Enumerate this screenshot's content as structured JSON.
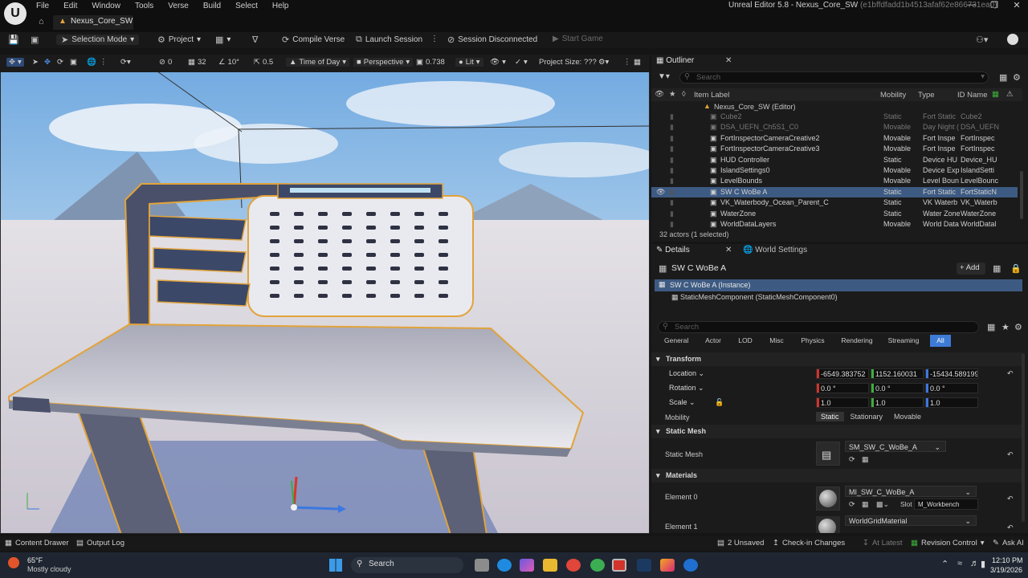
{
  "menu": [
    "File",
    "Edit",
    "Window",
    "Tools",
    "Verse",
    "Build",
    "Select",
    "Help"
  ],
  "window_title": "Unreal Editor 5.8 - Nexus_Core_SW",
  "window_hash": "(e1bffdfadd1b4513afaf62e866731ea0)",
  "tab_label": "Nexus_Core_SW",
  "toolbar": {
    "selection_mode": "Selection Mode",
    "project": "Project",
    "compile_verse": "Compile Verse",
    "launch_session": "Launch Session",
    "session_status": "Session Disconnected",
    "start_game": "Start Game"
  },
  "viewport_toolbar": {
    "snap_translate": "0",
    "grid": "32",
    "snap_rotate": "10°",
    "snap_scale": "0.5",
    "time_of_day": "Time of Day",
    "perspective": "Perspective",
    "camera_speed": "0.738",
    "lit": "Lit",
    "project_size": "Project Size: ???"
  },
  "outliner": {
    "tab": "Outliner",
    "search_placeholder": "Search",
    "columns": {
      "label": "Item Label",
      "mobility": "Mobility",
      "type": "Type",
      "id": "ID Name"
    },
    "root": "Nexus_Core_SW (Editor)",
    "rows": [
      {
        "label": "Cube2",
        "mobility": "Static",
        "type": "Fort Static",
        "id": "Cube2",
        "faded": true
      },
      {
        "label": "DSA_UEFN_Ch5S1_C0",
        "mobility": "Movable",
        "type": "Day Night (",
        "id": "DSA_UEFN",
        "faded": true
      },
      {
        "label": "FortInspectorCameraCreative2",
        "mobility": "Movable",
        "type": "Fort Inspe",
        "id": "FortInspec"
      },
      {
        "label": "FortInspectorCameraCreative3",
        "mobility": "Movable",
        "type": "Fort Inspe",
        "id": "FortInspec"
      },
      {
        "label": "HUD Controller",
        "mobility": "Static",
        "type": "Device HU",
        "id": "Device_HU"
      },
      {
        "label": "IslandSettings0",
        "mobility": "Movable",
        "type": "Device Exp",
        "id": "IslandSetti"
      },
      {
        "label": "LevelBounds",
        "mobility": "Movable",
        "type": "Level Boun",
        "id": "LevelBounc"
      },
      {
        "label": "SW C WoBe A",
        "mobility": "Static",
        "type": "Fort Static",
        "id": "FortStaticN",
        "selected": true
      },
      {
        "label": "VK_Waterbody_Ocean_Parent_C",
        "mobility": "Static",
        "type": "VK Waterb",
        "id": "VK_Waterb"
      },
      {
        "label": "WaterZone",
        "mobility": "Static",
        "type": "Water Zone",
        "id": "WaterZone"
      },
      {
        "label": "WorldDataLayers",
        "mobility": "Movable",
        "type": "World Data",
        "id": "WorldDatal"
      }
    ],
    "actor_count": "32 actors (1 selected)"
  },
  "details": {
    "tab": "Details",
    "tab2": "World Settings",
    "object_name": "SW C WoBe A",
    "add_label": "Add",
    "instance": "SW C WoBe A (Instance)",
    "component": "StaticMeshComponent (StaticMeshComponent0)",
    "search_placeholder": "Search",
    "filters": [
      "General",
      "Actor",
      "LOD",
      "Misc",
      "Physics",
      "Rendering",
      "Streaming",
      "All"
    ],
    "transform_header": "Transform",
    "location_label": "Location",
    "location": [
      "-6549.383752",
      "1152.160031",
      "-15434.589199"
    ],
    "rotation_label": "Rotation",
    "rotation": [
      "0.0 °",
      "0.0 °",
      "0.0 °"
    ],
    "scale_label": "Scale",
    "scale": [
      "1.0",
      "1.0",
      "1.0"
    ],
    "mobility_label": "Mobility",
    "mobility_options": [
      "Static",
      "Stationary",
      "Movable"
    ],
    "static_mesh_header": "Static Mesh",
    "static_mesh_label": "Static Mesh",
    "static_mesh_value": "SM_SW_C_WoBe_A",
    "materials_header": "Materials",
    "element0_label": "Element 0",
    "element0_value": "MI_SW_C_WoBe_A",
    "slot_label": "Slot",
    "slot_value": "M_Workbench",
    "element1_label": "Element 1",
    "element1_value": "WorldGridMaterial"
  },
  "statusbar": {
    "content_drawer": "Content Drawer",
    "output_log": "Output Log",
    "unsaved": "2 Unsaved",
    "check_in": "Check-in Changes",
    "at_latest": "At Latest",
    "revision": "Revision Control",
    "ask_ai": "Ask AI"
  },
  "taskbar": {
    "weather_temp": "65°F",
    "weather_desc": "Mostly cloudy",
    "search": "Search",
    "time": "12:10 PM",
    "date": "3/19/2026"
  },
  "colors": {
    "accent_blue": "#3d7bd6",
    "selection": "#3d5a82",
    "highlight_orange": "#e2a33a"
  }
}
